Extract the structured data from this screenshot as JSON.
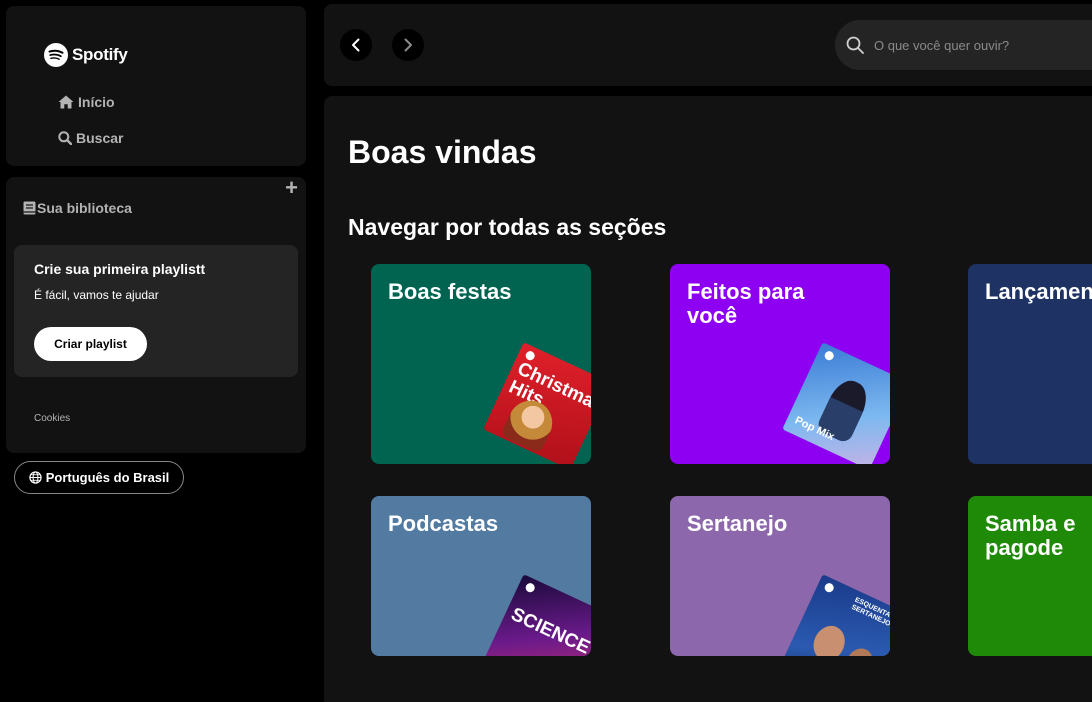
{
  "sidebar": {
    "logo_text": "Spotify",
    "nav": {
      "home_label": "Início",
      "search_label": "Buscar"
    },
    "library": {
      "title": "Sua biblioteca",
      "promo": {
        "title": "Crie sua primeira playlistt",
        "subtitle": "É fácil, vamos te ajudar",
        "button_label": "Criar playlist"
      },
      "cookies_label": "Cookies"
    },
    "language_button": "Português do Brasil"
  },
  "topbar": {
    "search_placeholder": "O que você quer ouvir?"
  },
  "main": {
    "title": "Boas vindas",
    "section_title": "Navegar por todas as seções",
    "cards": [
      {
        "title": "Boas festas",
        "color": "#006450",
        "art_text": "Christmas Hits"
      },
      {
        "title": "Feitos para você",
        "color": "#8D00F2",
        "art_text": "Pop Mix"
      },
      {
        "title": "Lançamentos",
        "color": "#1E3264"
      },
      {
        "title": "Podcastas",
        "color": "#537AA1",
        "art_text": "SCIENCE"
      },
      {
        "title": "Sertanejo",
        "color": "#8D67AB",
        "art_text": "ESQUENTA SERTANEJO"
      },
      {
        "title": "Samba e pagode",
        "color": "#1E8A08"
      }
    ]
  },
  "colors": {
    "background": "#000000",
    "panel": "#121212",
    "text_secondary": "#b3b3b3"
  }
}
